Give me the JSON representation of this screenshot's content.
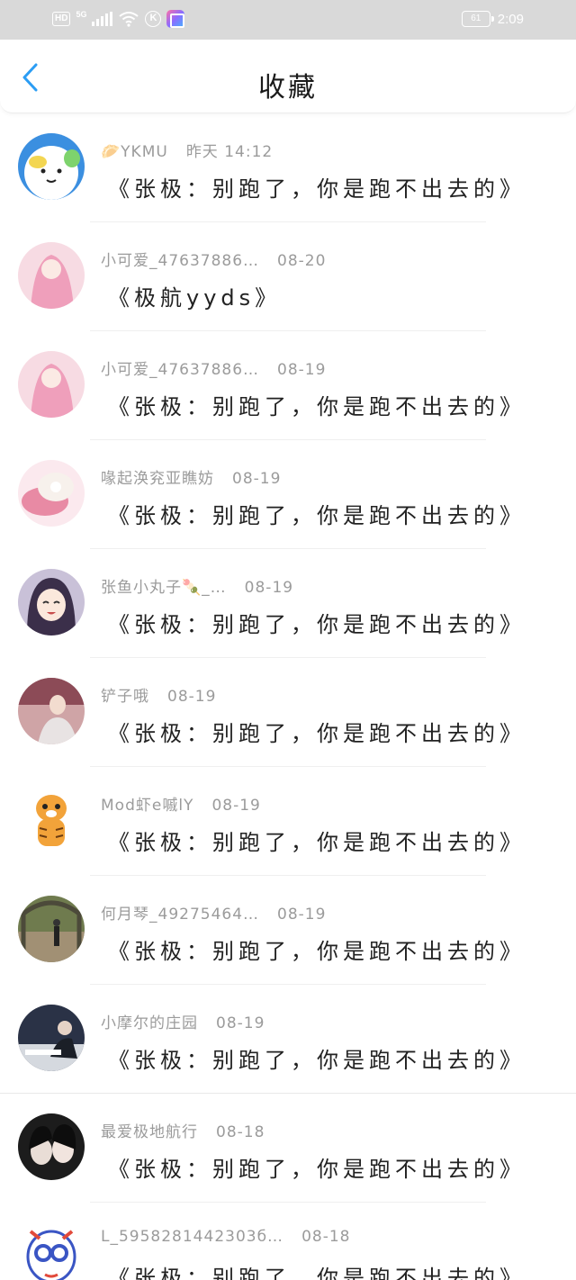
{
  "status_bar": {
    "hd": "HD",
    "network": "5G",
    "k_icon": "K",
    "battery": "61",
    "time": "2:09"
  },
  "nav": {
    "title": "收藏"
  },
  "items": [
    {
      "user": "🥟YKMU",
      "date": "昨天  14:12",
      "content": "《张极：别跑了，你是跑不出去的》"
    },
    {
      "user": "小可爱_47637886…",
      "date": "08-20",
      "content": "《极航yyds》"
    },
    {
      "user": "小可爱_47637886…",
      "date": "08-19",
      "content": "《张极：别跑了，你是跑不出去的》"
    },
    {
      "user": "喙起涣兖亚瞧妨",
      "date": "08-19",
      "content": "《张极：别跑了，你是跑不出去的》"
    },
    {
      "user": "张鱼小丸子🍡_…",
      "date": "08-19",
      "content": "《张极：别跑了，你是跑不出去的》"
    },
    {
      "user": "铲子哦",
      "date": "08-19",
      "content": "《张极：别跑了，你是跑不出去的》"
    },
    {
      "user": "Mod虾e嘁lY",
      "date": "08-19",
      "content": "《张极：别跑了，你是跑不出去的》"
    },
    {
      "user": "何月琴_49275464…",
      "date": "08-19",
      "content": "《张极：别跑了，你是跑不出去的》"
    },
    {
      "user": "小摩尔的庄园",
      "date": "08-19",
      "content": "《张极：别跑了，你是跑不出去的》"
    },
    {
      "user": "最爱极地航行",
      "date": "08-18",
      "content": "《张极：别跑了，你是跑不出去的》"
    },
    {
      "user": "L_5958281442303б…",
      "date": "08-18",
      "content": "《张极：别跑了，你是跑不出去的》"
    }
  ],
  "colors": {
    "accent": "#2b9df4",
    "meta_text": "#9b9b9b",
    "status_bar_bg": "#d9d9d9"
  }
}
